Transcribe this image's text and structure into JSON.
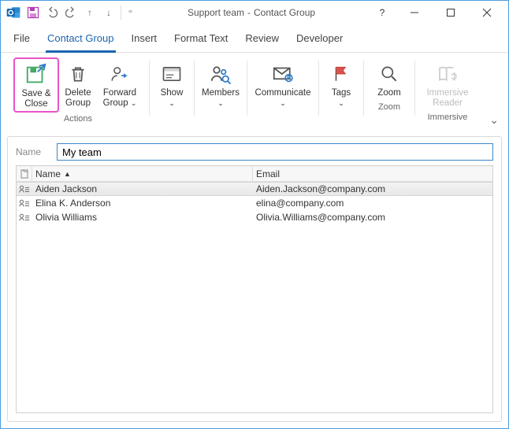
{
  "title": {
    "doc": "Support team",
    "type": "Contact Group"
  },
  "tabs": [
    "File",
    "Contact Group",
    "Insert",
    "Format Text",
    "Review",
    "Developer"
  ],
  "ribbon": {
    "save_close": "Save &\nClose",
    "delete_group": "Delete\nGroup",
    "forward_group": "Forward\nGroup",
    "show": "Show",
    "members": "Members",
    "communicate": "Communicate",
    "tags": "Tags",
    "zoom": "Zoom",
    "immersive_reader": "Immersive\nReader",
    "group_actions": "Actions",
    "group_zoom": "Zoom",
    "group_immersive": "Immersive"
  },
  "name_label": "Name",
  "name_value": "My team",
  "columns": {
    "name": "Name",
    "email": "Email"
  },
  "members": [
    {
      "name": "Aiden Jackson",
      "email": "Aiden.Jackson@company.com",
      "selected": true
    },
    {
      "name": "Elina K. Anderson",
      "email": "elina@company.com",
      "selected": false
    },
    {
      "name": "Olivia Williams",
      "email": "Olivia.Williams@company.com",
      "selected": false
    }
  ]
}
